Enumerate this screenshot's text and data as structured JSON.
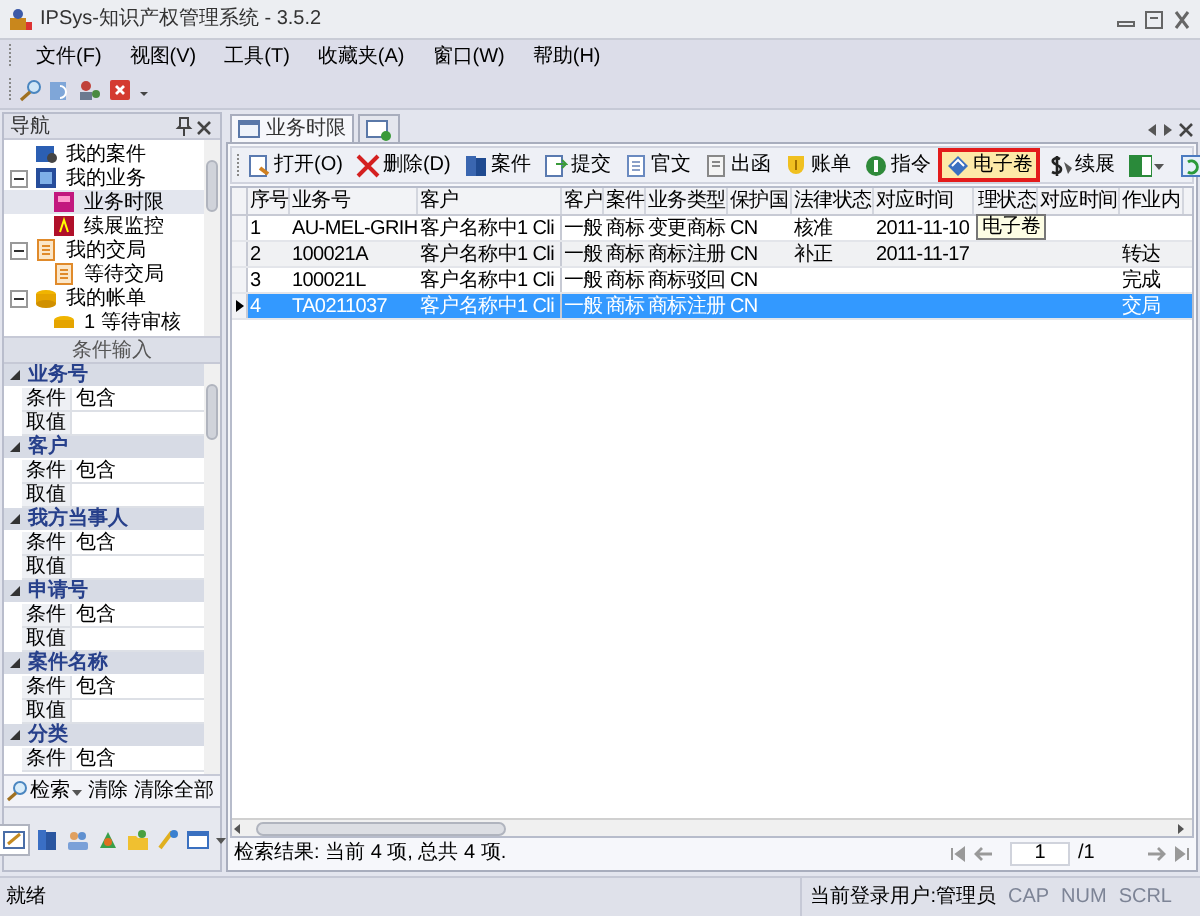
{
  "window": {
    "title": "IPSys-知识产权管理系统 - 3.5.2"
  },
  "menu": [
    "文件(F)",
    "视图(V)",
    "工具(T)",
    "收藏夹(A)",
    "窗口(W)",
    "帮助(H)"
  ],
  "navigation": {
    "title": "导航",
    "tree": [
      {
        "label": "我的案件",
        "selected": false
      },
      {
        "label": "我的业务",
        "expanded": true,
        "selected": false,
        "children": [
          {
            "label": "业务时限",
            "selected": true
          },
          {
            "label": "续展监控",
            "selected": false
          }
        ]
      },
      {
        "label": "我的交局",
        "expanded": true,
        "selected": false,
        "children": [
          {
            "label": "等待交局",
            "selected": false
          }
        ]
      },
      {
        "label": "我的帐单",
        "expanded": true,
        "selected": false,
        "children": [
          {
            "label": "1 等待审核",
            "selected": false
          }
        ]
      }
    ]
  },
  "filter": {
    "title": "条件输入",
    "groups": [
      {
        "label": "业务号",
        "expanded": true,
        "rows": [
          {
            "label": "条件",
            "value": "包含"
          },
          {
            "label": "取值"
          }
        ]
      },
      {
        "label": "客户",
        "expanded": true,
        "rows": [
          {
            "label": "条件",
            "value": "包含"
          },
          {
            "label": "取值"
          }
        ]
      },
      {
        "label": "我方当事人",
        "expanded": true,
        "rows": [
          {
            "label": "条件",
            "value": "包含"
          },
          {
            "label": "取值"
          }
        ]
      },
      {
        "label": "申请号",
        "expanded": true,
        "rows": [
          {
            "label": "条件",
            "value": "包含"
          },
          {
            "label": "取值"
          }
        ]
      },
      {
        "label": "案件名称",
        "expanded": true,
        "rows": [
          {
            "label": "条件",
            "value": "包含"
          },
          {
            "label": "取值"
          }
        ]
      },
      {
        "label": "分类",
        "expanded": true,
        "rows": [
          {
            "label": "条件",
            "value": "包含"
          }
        ]
      }
    ],
    "buttons": [
      "检索",
      "清除",
      "清除全部"
    ]
  },
  "tabs": [
    {
      "label": "业务时限",
      "selected": true
    }
  ],
  "toolbar": [
    {
      "kind": "button",
      "label": "打开(O)",
      "highlighted": false
    },
    {
      "kind": "button",
      "label": "删除(D)",
      "highlighted": false
    },
    {
      "kind": "button",
      "label": "案件",
      "highlighted": false
    },
    {
      "kind": "button",
      "label": "提交",
      "highlighted": false
    },
    {
      "kind": "button",
      "label": "官文",
      "highlighted": false
    },
    {
      "kind": "button",
      "label": "出函",
      "highlighted": false
    },
    {
      "kind": "button",
      "label": "账单",
      "highlighted": false
    },
    {
      "kind": "button",
      "label": "指令",
      "highlighted": false
    },
    {
      "kind": "button",
      "label": "电子卷",
      "highlighted": true
    },
    {
      "kind": "button",
      "label": "续展",
      "highlighted": false
    },
    {
      "kind": "dropdown",
      "highlighted": false
    },
    {
      "kind": "icon",
      "highlighted": false
    }
  ],
  "tooltip": "电子卷",
  "table": {
    "columns": [
      "序号",
      "业务号",
      "客户",
      "客户",
      "案件",
      "业务类型",
      "保护国",
      "法律状态",
      "对应时间",
      "理状态",
      "对应时间",
      "作业内"
    ],
    "rows": [
      {
        "selected": false,
        "cells": [
          "1",
          "AU-MEL-GRIH",
          "客户名称中1 Cli",
          "一般",
          "商标",
          "变更商标",
          "CN",
          "核准",
          "2011-11-10",
          null,
          null,
          null
        ]
      },
      {
        "selected": false,
        "cells": [
          "2",
          "100021A",
          "客户名称中1 Cli",
          "一般",
          "商标",
          "商标注册",
          "CN",
          "补正",
          "2011-11-17",
          null,
          null,
          "转达"
        ]
      },
      {
        "selected": false,
        "cells": [
          "3",
          "100021L",
          "客户名称中1 Cli",
          "一般",
          "商标",
          "商标驳回",
          "CN",
          null,
          null,
          null,
          null,
          "完成"
        ]
      },
      {
        "selected": true,
        "cells": [
          "4",
          "TA0211037",
          "客户名称中1 Cli",
          "一般",
          "商标",
          "商标注册",
          "CN",
          null,
          null,
          null,
          null,
          "交局"
        ]
      }
    ]
  },
  "result": "检索结果: 当前 4 项, 总共 4 项.",
  "pager": {
    "page": "1",
    "total": "/1"
  },
  "status_bar": {
    "text": "就绪",
    "user": "当前登录用户:管理员",
    "indicators": [
      {
        "label": "CAP",
        "on": false
      },
      {
        "label": "NUM",
        "on": false
      },
      {
        "label": "SCRL",
        "on": false
      }
    ]
  }
}
